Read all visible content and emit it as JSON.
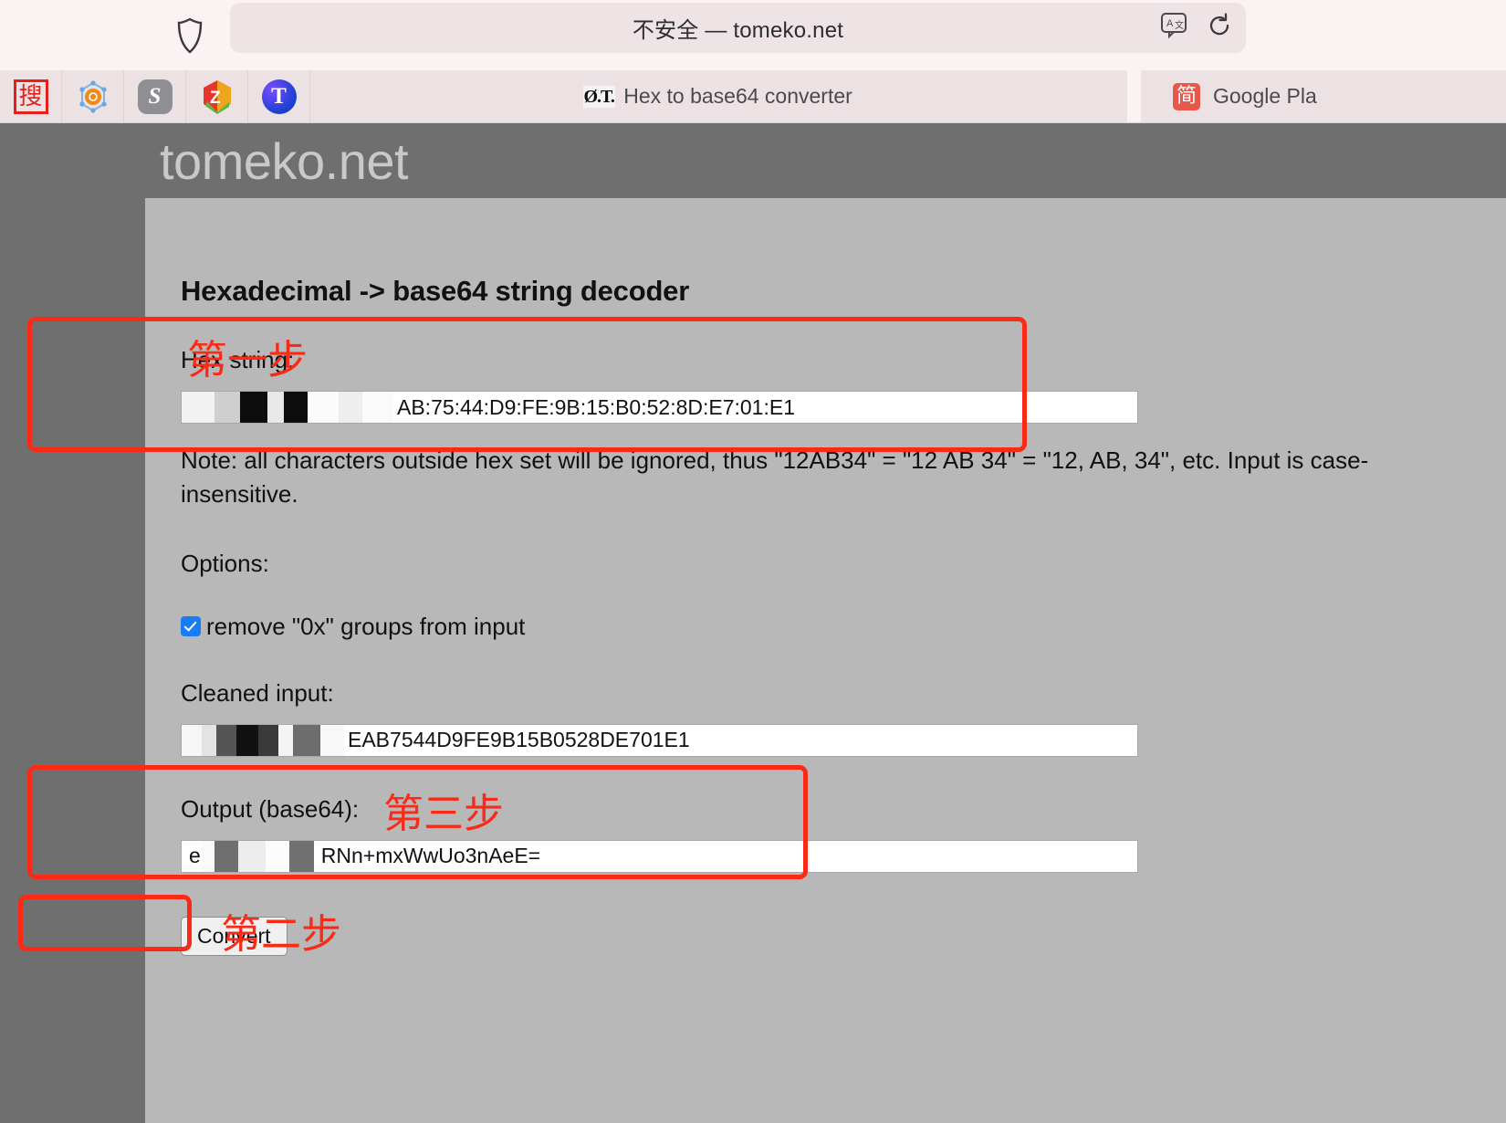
{
  "browser": {
    "security_label": "不安全",
    "separator": "—",
    "domain": "tomeko.net",
    "address_text": "不安全 — tomeko.net",
    "sidebar_icon": "shield-icon",
    "translate_icon": "translate-icon",
    "reload_icon": "reload-icon",
    "bookmarks": [
      {
        "name": "sogou",
        "glyph": "搜"
      },
      {
        "name": "hexagon-orange",
        "glyph": ""
      },
      {
        "name": "s-app",
        "glyph": "S"
      },
      {
        "name": "zotero",
        "glyph": "Z"
      },
      {
        "name": "t-app",
        "glyph": "T"
      }
    ],
    "tabs": [
      {
        "title": "Hex to base64 converter",
        "favicon": "ot-favicon",
        "favicon_text": "Ø.T.",
        "active": true
      },
      {
        "title": "Google Pla",
        "favicon": "jian-favicon",
        "favicon_text": "简",
        "active": false
      }
    ]
  },
  "page": {
    "wordmark": "tomeko.net",
    "title": "Hexadecimal -> base64 string decoder",
    "hex_label": "Hex string:",
    "hex_value": "AB:75:44:D9:FE:9B:15:B0:52:8D:E7:01:E1",
    "note": "Note: all characters outside hex set will be ignored, thus \"12AB34\" = \"12 AB 34\" = \"12, AB, 34\", etc. Input is case-insensitive.",
    "options_label": "Options:",
    "option_checkbox_label": "remove \"0x\" groups from input",
    "option_checked": true,
    "cleaned_label": "Cleaned input:",
    "cleaned_value": "EAB7544D9FE9B15B0528DE701E1",
    "output_label": "Output (base64):",
    "output_value_prefix": "e",
    "output_value": "RNn+mxWwUo3nAeE=",
    "convert_button": "Convert"
  },
  "annotations": {
    "accent_color": "#fb2a17",
    "step1": "第一步",
    "step2": "第二步",
    "step3": "第三步"
  }
}
